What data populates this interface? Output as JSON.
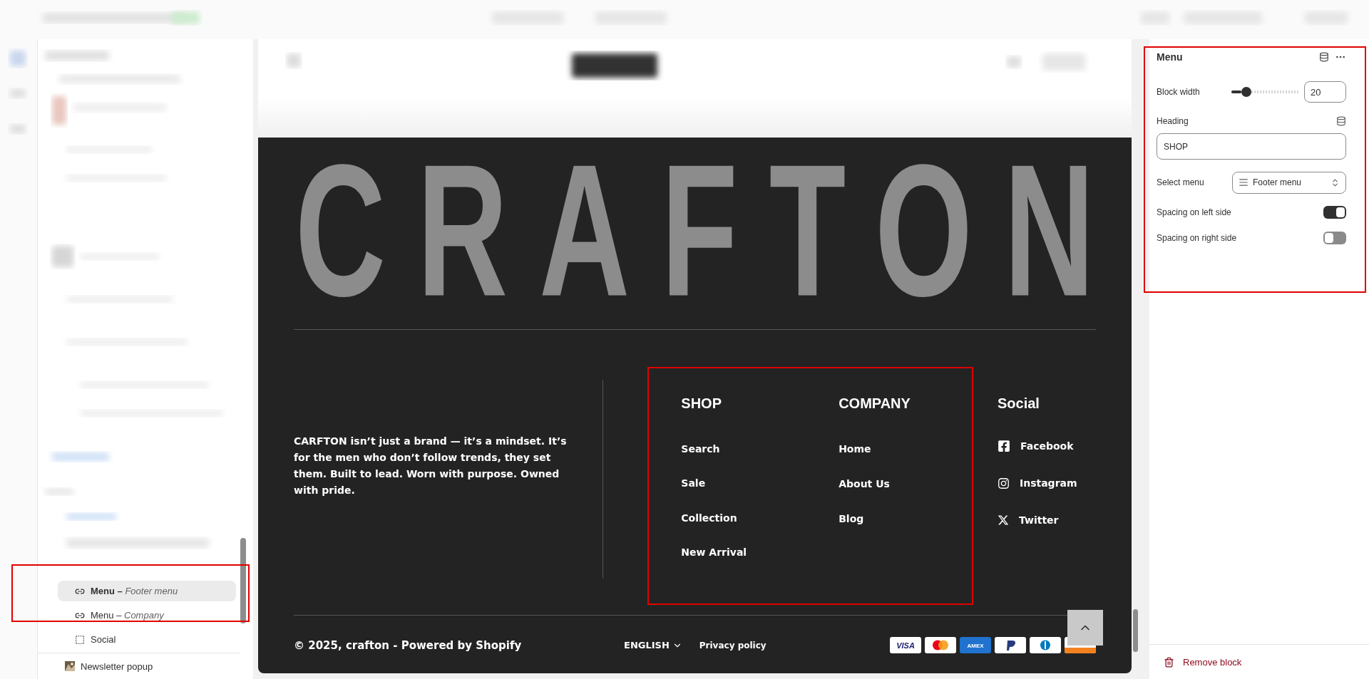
{
  "sidebar": {
    "items": [
      {
        "kind": "link",
        "label": "Menu",
        "separator": "–",
        "detail": "Footer menu",
        "selected": true
      },
      {
        "kind": "link",
        "label": "Menu",
        "separator": "–",
        "detail": "Company",
        "selected": false
      },
      {
        "kind": "group",
        "label": "Social",
        "selected": false
      }
    ],
    "section": {
      "label": "Newsletter popup"
    }
  },
  "preview": {
    "footer": {
      "wordmark": "CRAFTON",
      "about": "CARFTON isn’t just a brand — it’s a mindset. It’s for the men who don’t follow trends, they set them. Built to lead. Worn with purpose. Owned with pride.",
      "columns": [
        {
          "heading": "SHOP",
          "links": [
            "Search",
            "Sale",
            "Collection",
            "New Arrival"
          ]
        },
        {
          "heading": "COMPANY",
          "links": [
            "Home",
            "About Us",
            "Blog"
          ]
        }
      ],
      "social": {
        "heading": "Social",
        "links": [
          {
            "kind": "facebook",
            "label": "Facebook"
          },
          {
            "kind": "instagram",
            "label": "Instagram"
          },
          {
            "kind": "x",
            "label": "Twitter"
          }
        ]
      },
      "copyright": "© 2025, crafton - Powered by Shopify",
      "language": "ENGLISH",
      "policy": "Privacy policy",
      "payments": [
        {
          "kind": "visa",
          "label": "VISA"
        },
        {
          "kind": "mastercard"
        },
        {
          "kind": "amex",
          "label": "AMEX"
        },
        {
          "kind": "paypal"
        },
        {
          "kind": "diners"
        },
        {
          "kind": "discover"
        }
      ]
    }
  },
  "panel": {
    "title": "Menu",
    "fields": [
      {
        "kind": "slider",
        "label": "Block width",
        "level": 0.15,
        "value": "20"
      },
      {
        "kind": "text",
        "label": "Heading",
        "value": "SHOP"
      },
      {
        "kind": "select",
        "label": "Select menu",
        "value": "Footer menu"
      },
      {
        "kind": "toggle",
        "label": "Spacing on left side",
        "on": true
      },
      {
        "kind": "toggle",
        "label": "Spacing on right side",
        "on": false
      }
    ],
    "remove": "Remove block"
  }
}
